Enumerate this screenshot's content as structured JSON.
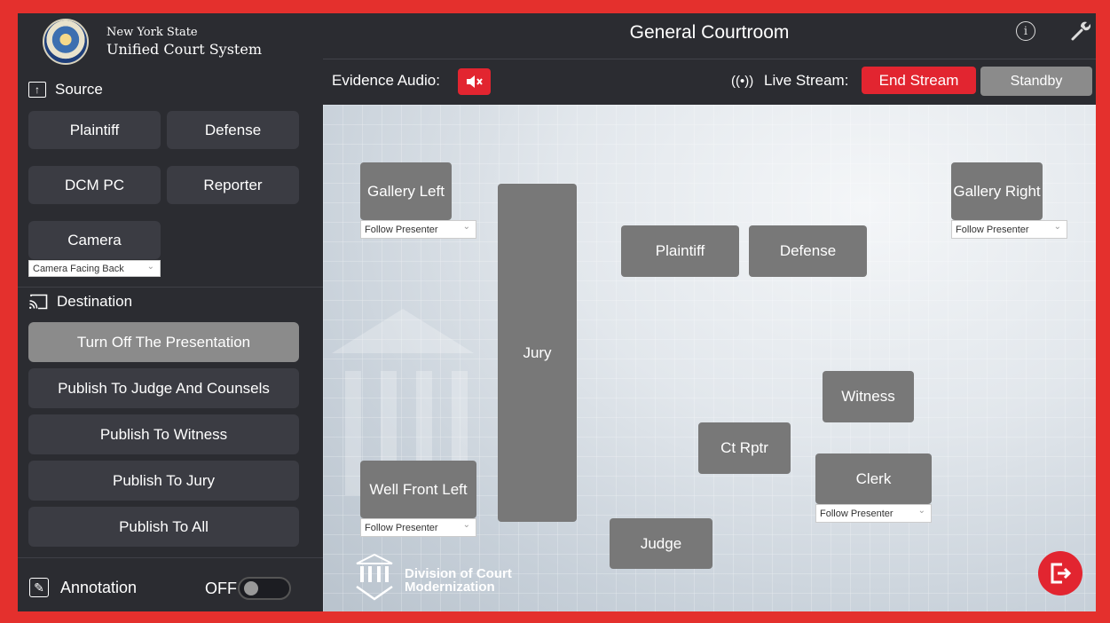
{
  "header": {
    "org_line1": "New York State",
    "org_line2": "Unified Court System",
    "title": "General Courtroom"
  },
  "source": {
    "label": "Source",
    "buttons": [
      "Plaintiff",
      "Defense",
      "DCM PC",
      "Reporter",
      "Camera"
    ],
    "camera_dropdown": "Camera Facing Back"
  },
  "destination": {
    "label": "Destination",
    "buttons": [
      "Turn Off The Presentation",
      "Publish To Judge And Counsels",
      "Publish To Witness",
      "Publish To Jury",
      "Publish To All"
    ],
    "active_index": 0
  },
  "annotation": {
    "label": "Annotation",
    "state": "OFF"
  },
  "toolbar": {
    "evidence_audio_label": "Evidence Audio:",
    "live_stream_label": "Live Stream:",
    "end_stream": "End Stream",
    "standby": "Standby"
  },
  "seats": {
    "gallery_left": "Gallery Left",
    "gallery_right": "Gallery Right",
    "jury": "Jury",
    "plaintiff": "Plaintiff",
    "defense": "Defense",
    "witness": "Witness",
    "ct_rptr": "Ct Rptr",
    "clerk": "Clerk",
    "well_front_left": "Well Front Left",
    "judge": "Judge",
    "follow_presenter": "Follow Presenter"
  },
  "footer": {
    "dcm_line1": "Division of Court",
    "dcm_line2": "Modernization"
  },
  "colors": {
    "accent_red": "#e22530",
    "panel": "#2b2c31",
    "button": "#3b3c43",
    "seat": "#787878"
  },
  "icons": [
    "upload-icon",
    "cast-icon",
    "edit-icon",
    "info-icon",
    "wrench-icon",
    "mute-icon",
    "broadcast-icon",
    "exit-icon"
  ]
}
